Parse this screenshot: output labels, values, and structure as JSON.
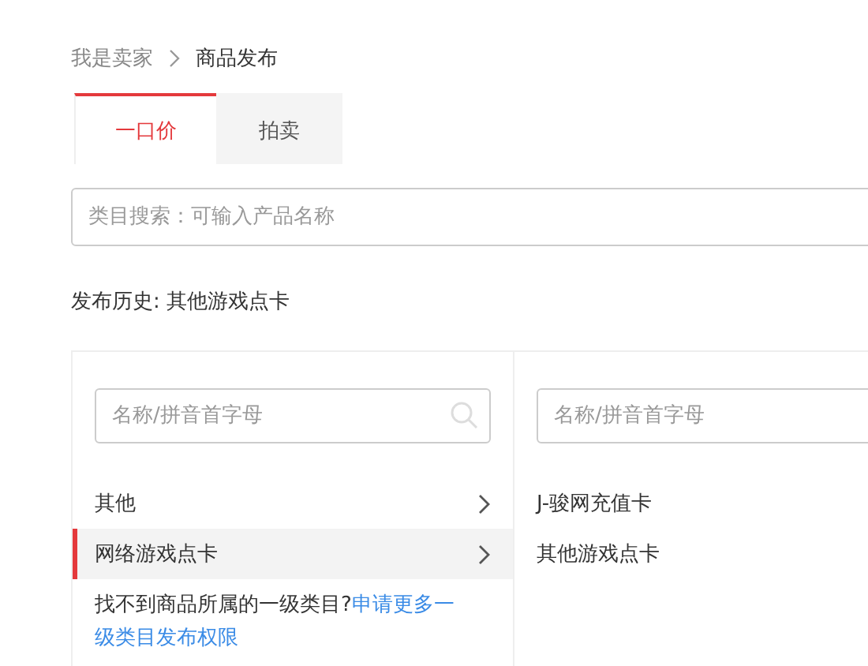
{
  "breadcrumb": [
    "我是卖家",
    "商品发布"
  ],
  "tabs": [
    {
      "label": "一口价",
      "selected": true
    },
    {
      "label": "拍卖",
      "selected": false
    }
  ],
  "category_search": {
    "placeholder": "类目搜索：可输入产品名称"
  },
  "history": {
    "label": "发布历史:",
    "value": "其他游戏点卡"
  },
  "columns": [
    {
      "search": {
        "placeholder": "名称/拼音首字母"
      },
      "items": [
        {
          "label": "其他",
          "selected": false,
          "expandable": true
        },
        {
          "label": "网络游戏点卡",
          "selected": true,
          "expandable": true
        }
      ],
      "note": {
        "text": "找不到商品所属的一级类目?",
        "link_lines": [
          "申请更多一",
          "级类目发布权限"
        ]
      }
    },
    {
      "search": {
        "placeholder": "名称/拼音首字母"
      },
      "items": [
        {
          "label": "J-骏网充值卡",
          "selected": false
        },
        {
          "label": "其他游戏点卡",
          "selected": false
        }
      ]
    }
  ]
}
